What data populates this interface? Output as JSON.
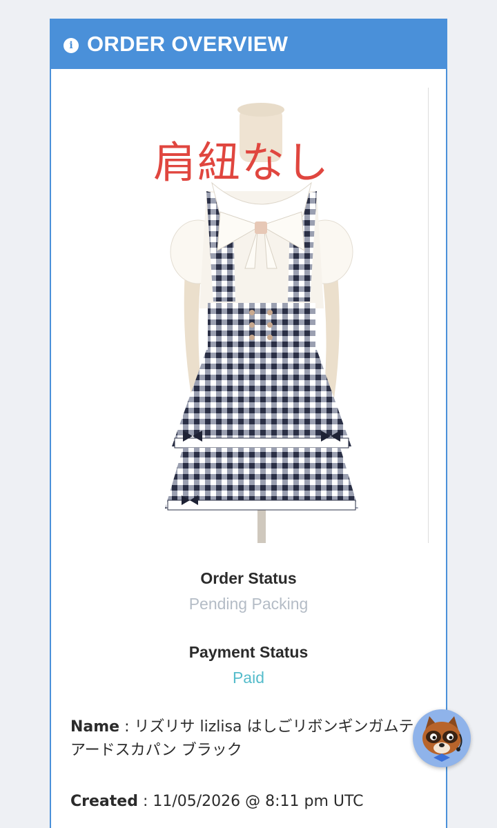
{
  "header": {
    "title": "ORDER OVERVIEW",
    "icon": "info-icon"
  },
  "product": {
    "overlay_text": "肩紐なし",
    "image_description_icon": "dress-photo"
  },
  "order_status": {
    "label": "Order Status",
    "value": "Pending Packing",
    "color": "#b4bcc6"
  },
  "payment_status": {
    "label": "Payment Status",
    "value": "Paid",
    "color": "#55bccb"
  },
  "details": {
    "name_label": "Name",
    "name_separator": " : ",
    "name_value": "リズリサ lizlisa はしごリボンギンガムティアードスカパン ブラック",
    "created_label": "Created",
    "created_separator": " : ",
    "created_value": "11/05/2026 @ 8:11 pm UTC"
  },
  "chat": {
    "icon": "raccoon-support-icon"
  },
  "colors": {
    "accent": "#4a90d9",
    "background": "#eef0f4"
  }
}
